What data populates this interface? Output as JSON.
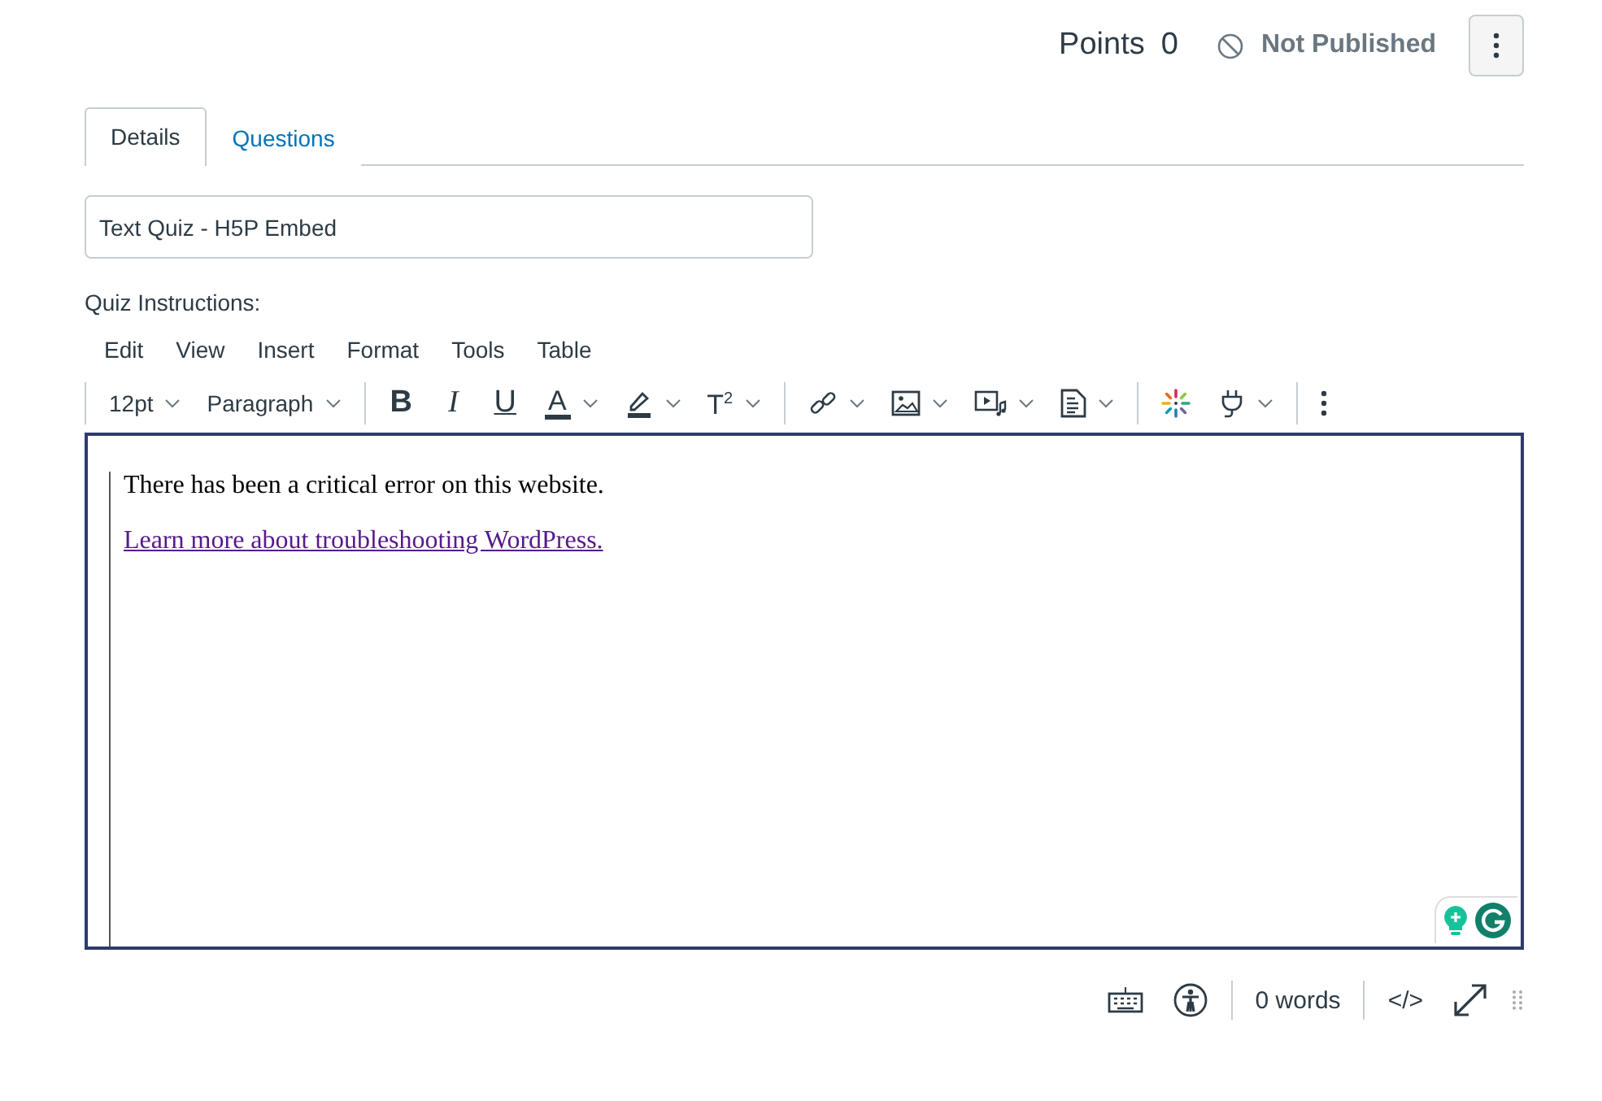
{
  "header": {
    "points_label": "Points",
    "points_value": "0",
    "publish_status": "Not Published",
    "published": false
  },
  "tabs": [
    {
      "label": "Details",
      "selected": true
    },
    {
      "label": "Questions",
      "selected": false
    }
  ],
  "title_field": {
    "value": "Text Quiz - H5P Embed"
  },
  "instructions_label": "Quiz Instructions:",
  "menu": [
    "Edit",
    "View",
    "Insert",
    "Format",
    "Tools",
    "Table"
  ],
  "toolbar": [
    [
      {
        "kind": "select",
        "label": "12pt"
      },
      {
        "kind": "select",
        "label": "Paragraph"
      }
    ],
    [
      {
        "kind": "bold",
        "label": "B"
      },
      {
        "kind": "italic",
        "label": "I"
      },
      {
        "kind": "underline",
        "label": "U"
      },
      {
        "kind": "textcolor",
        "label": "A",
        "caret": true
      },
      {
        "kind": "highlight",
        "caret": true
      },
      {
        "kind": "superscript",
        "label": "T$^{2}$",
        "caret": true
      }
    ],
    [
      {
        "kind": "link",
        "caret": true
      },
      {
        "kind": "image",
        "caret": true
      },
      {
        "kind": "media",
        "caret": true
      },
      {
        "kind": "document",
        "caret": true
      }
    ],
    [
      {
        "kind": "apps"
      },
      {
        "kind": "plugin",
        "caret": true
      }
    ],
    [
      {
        "kind": "more"
      }
    ]
  ],
  "content": [
    {
      "kind": "text",
      "text": "There has been a critical error on this website."
    },
    {
      "kind": "link",
      "text": "Learn more about troubleshooting WordPress."
    }
  ],
  "footer": {
    "word_count": "0 words",
    "code_toggle": "</>"
  }
}
